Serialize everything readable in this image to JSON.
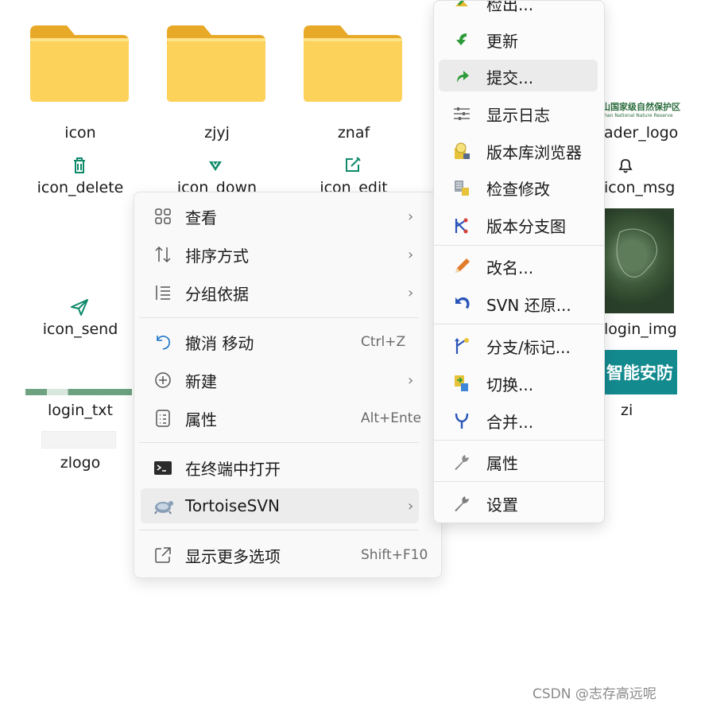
{
  "desktop": {
    "folders": [
      {
        "label": "icon"
      },
      {
        "label": "zjyj"
      },
      {
        "label": "znaf"
      }
    ],
    "files": {
      "icon_delete": "icon_delete",
      "icon_down": "icon_down",
      "icon_edit": "icon_edit",
      "icon_send": "icon_send",
      "login_txt": "login_txt",
      "zlogo": "zlogo",
      "header_logo": "ader_logo",
      "header_logo_text": "山国家级自然保护区",
      "header_logo_sub": "shan National Nature Reserve",
      "icon_msg": "icon_msg",
      "login_img": "login_img",
      "zi": "zi",
      "zi_banner_text": "智能安防"
    }
  },
  "context_menu": {
    "items": [
      {
        "label": "查看",
        "icon": "grid-icon",
        "submenu": true
      },
      {
        "label": "排序方式",
        "icon": "sort-icon",
        "submenu": true
      },
      {
        "label": "分组依据",
        "icon": "group-list-icon",
        "submenu": true
      },
      {
        "label": "撤消 移动",
        "icon": "undo-icon",
        "shortcut": "Ctrl+Z"
      },
      {
        "label": "新建",
        "icon": "plus-circle-icon",
        "submenu": true
      },
      {
        "label": "属性",
        "icon": "properties-icon",
        "shortcut": "Alt+Ente"
      },
      {
        "label": "在终端中打开",
        "icon": "terminal-icon"
      },
      {
        "label": "TortoiseSVN",
        "icon": "tortoise-icon",
        "submenu": true
      },
      {
        "label": "显示更多选项",
        "icon": "share-icon",
        "shortcut": "Shift+F10"
      }
    ],
    "chevron": "›"
  },
  "svn_menu": {
    "items": [
      {
        "label": "检出...",
        "icon": "checkout-icon"
      },
      {
        "label": "更新",
        "icon": "update-icon"
      },
      {
        "label": "提交...",
        "icon": "commit-icon"
      },
      {
        "label": "显示日志",
        "icon": "log-icon"
      },
      {
        "label": "版本库浏览器",
        "icon": "repo-browser-icon"
      },
      {
        "label": "检查修改",
        "icon": "check-modifications-icon"
      },
      {
        "label": "版本分支图",
        "icon": "revision-graph-icon"
      },
      {
        "label": "改名...",
        "icon": "rename-icon"
      },
      {
        "label": "SVN 还原...",
        "icon": "revert-icon"
      },
      {
        "label": "分支/标记...",
        "icon": "branch-tag-icon"
      },
      {
        "label": "切换...",
        "icon": "switch-icon"
      },
      {
        "label": "合并...",
        "icon": "merge-icon"
      },
      {
        "label": "属性",
        "icon": "wrench-icon"
      },
      {
        "label": "设置",
        "icon": "settings-wrench-icon"
      }
    ]
  },
  "watermark": "CSDN @志存高远呢",
  "colors": {
    "folder_yellow": "#f7c53f",
    "icon_green": "#0e8a6a",
    "banner_teal": "#138a8e",
    "svn_green": "#2e9b3a",
    "svn_blue": "#2a55b8"
  }
}
